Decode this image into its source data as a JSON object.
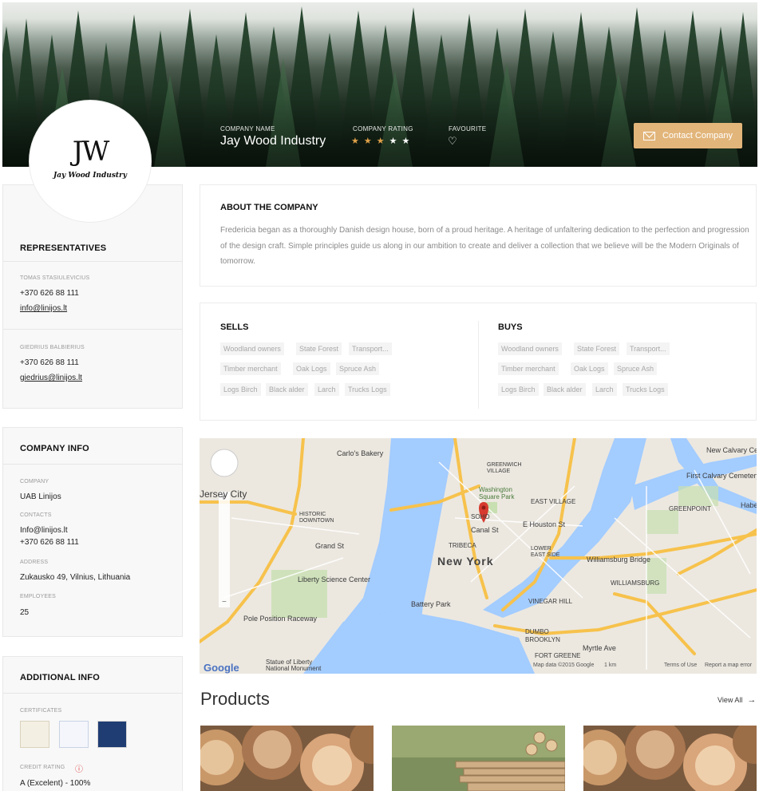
{
  "hero": {
    "company_name_label": "COMPANY NAME",
    "company_name": "Jay Wood Industry",
    "rating_label": "COMPANY RATING",
    "rating_value": 3,
    "rating_max": 5,
    "favourite_label": "FAVOURITE",
    "contact_button": "Contact Company"
  },
  "logo": {
    "mark": "JW",
    "text": "Jay Wood Industry"
  },
  "representatives": {
    "title": "REPRESENTATIVES",
    "people": [
      {
        "name": "TOMAS STASIULEVICIUS",
        "phone": "+370 626 88 111",
        "email": "info@linijos.lt"
      },
      {
        "name": "GIEDRIUS BALBIERIUS",
        "phone": "+370 626 88 111",
        "email": "giedrius@linijos.lt"
      }
    ]
  },
  "company_info": {
    "title": "COMPANY INFO",
    "company_label": "COMPANY",
    "company": "UAB Linijos",
    "contacts_label": "CONTACTS",
    "contacts_email": "Info@linijos.lt",
    "contacts_phone": "+370 626 88 111",
    "address_label": "ADDRESS",
    "address": "Zukausko 49, Vilnius, Lithuania",
    "employees_label": "EMPLOYEES",
    "employees": "25"
  },
  "additional_info": {
    "title": "ADDITIONAL INFO",
    "certificates_label": "CERTIFICATES",
    "credit_rating_label": "CREDIT RATING",
    "credit_rating": "A (Excelent) - 100%"
  },
  "about": {
    "title": "ABOUT THE COMPANY",
    "text": "Fredericia began as a thoroughly Danish design house, born of a proud heritage. A heritage of unfaltering dedication to the perfection and progression of the design craft. Simple principles guide us along in our ambition to create and deliver a collection that we believe will be the Modern Originals of tomorrow."
  },
  "sells": {
    "title": "SELLS",
    "rows": [
      [
        "Woodland owners",
        "State Forest",
        "Transport..."
      ],
      [
        "Timber merchant",
        "Oak Logs",
        "Spruce Ash"
      ],
      [
        "Logs Birch",
        "Black alder",
        "Larch",
        "Trucks Logs"
      ]
    ]
  },
  "buys": {
    "title": "BUYS",
    "rows": [
      [
        "Woodland owners",
        "State Forest",
        "Transport..."
      ],
      [
        "Timber merchant",
        "Oak Logs",
        "Spruce Ash"
      ],
      [
        "Logs Birch",
        "Black alder",
        "Larch",
        "Trucks Logs"
      ]
    ]
  },
  "map": {
    "labels": {
      "carlos": "Carlo's Bakery",
      "jersey": "Jersey City",
      "grand": "Grand St",
      "liberty_sc": "Liberty Science Center",
      "pole": "Pole Position Raceway",
      "statue": "Statue of Liberty\nNational Monument",
      "newyork": "New York",
      "battery": "Battery Park",
      "tribeca": "TRIBECA",
      "soho": "SOHO",
      "washington": "Washington\nSquare Park",
      "east_village": "EAST VILLAGE",
      "greenwich": "GREENWICH\nVILLAGE",
      "lower_east": "LOWER\nEAST SIDE",
      "williamsburg_bridge": "Williamsburg Bridge",
      "williamsburg": "WILLIAMSBURG",
      "greenpoint": "GREENPOINT",
      "vinegar": "VINEGAR HILL",
      "dumbo": "DUMBO",
      "brooklyn": "BROOKLYN",
      "first_calvary": "First Calvary Cemetery",
      "new_calvary": "New Calvary Cem",
      "fort_greene": "FORT GREENE",
      "historic": "HISTORIC\nDOWNTOWN",
      "e_houston": "E Houston St",
      "canal": "Canal St",
      "myrtle": "Myrtle Ave",
      "habe": "Habe"
    },
    "google": "Google",
    "footer_data": "Map data ©2015 Google",
    "footer_scale": "1 km",
    "footer_terms": "Terms of Use",
    "footer_report": "Report a map error"
  },
  "products": {
    "title": "Products",
    "view_all": "View All"
  },
  "colors": {
    "accent": "#e2b57a",
    "star_on": "#e0a149",
    "water": "#a3ccff",
    "road": "#f7c24c"
  }
}
